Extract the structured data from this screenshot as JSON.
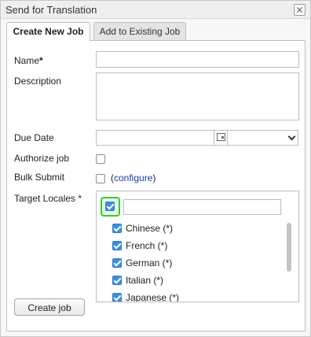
{
  "dialog": {
    "title": "Send for Translation"
  },
  "tabs": [
    {
      "label": "Create New Job",
      "active": true
    },
    {
      "label": "Add to Existing Job",
      "active": false
    }
  ],
  "form": {
    "name_label": "Name",
    "required_mark": "*",
    "description_label": "Description",
    "due_date_label": "Due Date",
    "authorize_label": "Authorize job",
    "bulk_submit_label": "Bulk Submit",
    "configure_open": "(",
    "configure_link": "configure",
    "configure_close": ")",
    "target_locales_label": "Target Locales *",
    "authorize_checked": false,
    "bulk_submit_checked": false
  },
  "locales": {
    "select_all_checked": true,
    "filter_value": "",
    "items": [
      {
        "name": "Chinese (*)",
        "checked": true
      },
      {
        "name": "French (*)",
        "checked": true
      },
      {
        "name": "German (*)",
        "checked": true
      },
      {
        "name": "Italian (*)",
        "checked": true
      },
      {
        "name": "Japanese (*)",
        "checked": true
      }
    ]
  },
  "actions": {
    "create_label": "Create job"
  },
  "colors": {
    "accent": "#3b8fe0",
    "highlight": "#33cc33",
    "link": "#1b3fa0"
  }
}
